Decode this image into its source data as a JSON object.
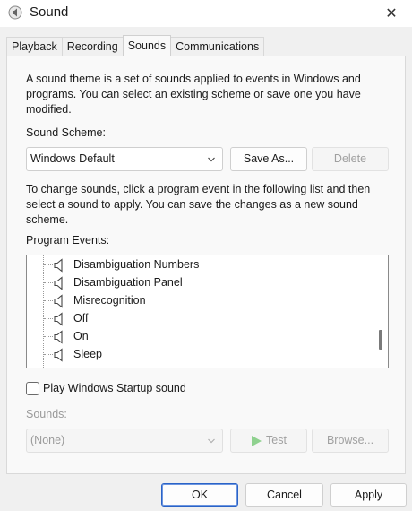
{
  "window": {
    "title": "Sound",
    "close_glyph": "✕"
  },
  "tabs": [
    {
      "label": "Playback"
    },
    {
      "label": "Recording"
    },
    {
      "label": "Sounds"
    },
    {
      "label": "Communications"
    }
  ],
  "sounds_tab": {
    "intro": "A sound theme is a set of sounds applied to events in Windows and programs.  You can select an existing scheme or save one you have modified.",
    "scheme_label": "Sound Scheme:",
    "scheme_value": "Windows Default",
    "save_as_label": "Save As...",
    "delete_label": "Delete",
    "instructions": "To change sounds, click a program event in the following list and then select a sound to apply.  You can save the changes as a new sound scheme.",
    "events_label": "Program Events:",
    "events": [
      {
        "label": "Disambiguation Numbers"
      },
      {
        "label": "Disambiguation Panel"
      },
      {
        "label": "Misrecognition"
      },
      {
        "label": "Off"
      },
      {
        "label": "On"
      },
      {
        "label": "Sleep"
      }
    ],
    "startup_sound_label": "Play Windows Startup sound",
    "startup_sound_checked": false,
    "sounds_label": "Sounds:",
    "sounds_value": "(None)",
    "test_label": "Test",
    "browse_label": "Browse..."
  },
  "footer": {
    "ok_label": "OK",
    "cancel_label": "Cancel",
    "apply_label": "Apply"
  },
  "icons": {
    "app": "speaker-icon",
    "event": "speaker-icon",
    "test": "play-icon"
  },
  "colors": {
    "primary_border": "#2a63c7",
    "test_arrow": "#8fd18f"
  }
}
